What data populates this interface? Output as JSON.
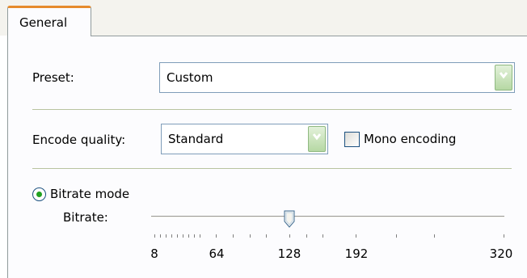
{
  "tabs": [
    {
      "label": "General",
      "active": true
    }
  ],
  "preset": {
    "label": "Preset:",
    "value": "Custom"
  },
  "encode_quality": {
    "label": "Encode quality:",
    "value": "Standard"
  },
  "mono_encoding": {
    "label": "Mono encoding",
    "checked": false
  },
  "bitrate_mode": {
    "label": "Bitrate mode",
    "selected": true
  },
  "bitrate": {
    "label": "Bitrate:",
    "value": 128,
    "ticks": [
      "8",
      "64",
      "128",
      "192",
      "320"
    ]
  },
  "colors": {
    "tab_accent": "#e68b2c",
    "combo_button": "#b6d8a4",
    "radio_dot": "#21a121"
  }
}
